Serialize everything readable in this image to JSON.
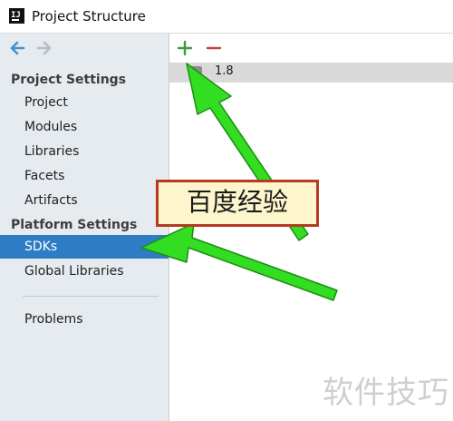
{
  "window": {
    "title": "Project Structure"
  },
  "sidebar": {
    "project_settings_header": "Project Settings",
    "project_items": [
      {
        "label": "Project"
      },
      {
        "label": "Modules"
      },
      {
        "label": "Libraries"
      },
      {
        "label": "Facets"
      },
      {
        "label": "Artifacts"
      }
    ],
    "platform_settings_header": "Platform Settings",
    "platform_items": [
      {
        "label": "SDKs",
        "selected": true
      },
      {
        "label": "Global Libraries"
      }
    ],
    "other_items": [
      {
        "label": "Problems"
      }
    ]
  },
  "toolbar": {
    "add_icon": "plus-icon",
    "remove_icon": "minus-icon"
  },
  "sdk_list": [
    {
      "name": "1.8"
    }
  ],
  "annotation": {
    "text": "百度经验"
  },
  "watermark": {
    "text": "软件技巧"
  },
  "colors": {
    "selection": "#2e7cc4",
    "sidebar_bg": "#e6ebf0",
    "arrow_green": "#33dd22",
    "add_green": "#3e9a3e",
    "remove_red": "#c8423b"
  }
}
